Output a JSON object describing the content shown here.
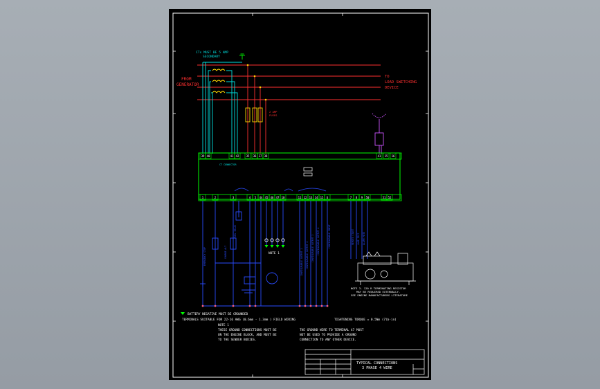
{
  "title_block": {
    "title_line1": "TYPICAL CONNECTIONS",
    "title_line2": "3 PHASE 4 WIRE"
  },
  "labels": {
    "ct_note_line1": "CTs MUST BE 5 AMP",
    "ct_note_line2": "SECONDARY",
    "from_generator_line1": "FROM",
    "from_generator_line2": "GENERATOR",
    "to_load_line1": "TO",
    "to_load_line2": "LOAD SWITCHING",
    "to_load_line3": "DEVICE",
    "fuses_line1": "2 AMP",
    "fuses_line2": "FUSES",
    "ct_connector_caption": "CT CONNECTOR",
    "note1_marker": "NOTE 1",
    "battery_negative": "BATTERY NEGATIVE MUST BE GROUNDED",
    "terminals_suitable": "TERMINALS SUITABLE FOR 22-16 AWG (0.6mm - 1.3mm ) FIELD WIRING",
    "tightening_torque": "TIGHTENING TORQUE = 0.5Nm (7lb-in)",
    "note1_heading": "NOTE 1",
    "note1_line1": "THESE GROUND CONNECTIONS MUST BE",
    "note1_line2": "ON THE ENGINE BLOCK, AND MUST BE",
    "note1_line3": "TO THE SENDER BODIES.",
    "note2_line1": "THE GROUND WIRE TO TERMINAL 47 MUST",
    "note2_line2": "NOT BE USED TO PROVIDE A GROUND",
    "note2_line3": "CONNECTION TO ANY OTHER DEVICE.",
    "note3_line1": "NOTE 3. 120 R TERMINATING RESISTOR",
    "note3_line2": "MAY BE REQUIRED EXTERNALLY.",
    "note3_line3": "SEE ENGINE MANUFACTURERS LITERATURE"
  },
  "top_terminals": [
    "39",
    "40",
    "41",
    "42",
    "35",
    "36",
    "37",
    "38"
  ],
  "top_right_terminals": [
    "41",
    "15",
    "16"
  ],
  "bottom_terminals": [
    "1",
    "2",
    "3",
    "4",
    "5",
    "44",
    "45",
    "46",
    "47",
    "10",
    "11",
    "12",
    "13",
    "14",
    "15",
    "6",
    "7",
    "8",
    "9",
    "50",
    "51",
    "52"
  ],
  "colors": {
    "sheet": "#000000",
    "border": "#ffffff",
    "phase_lines": "#ff3030",
    "ct_wiring": "#00e0e0",
    "module_outline": "#00ff00",
    "dc_wiring": "#2a4cff",
    "fuse": "#ffd700",
    "can_wiring": "#cc55ff",
    "ground_symbol": "#00ff00",
    "notes_text": "#ffffff",
    "labels_text": "#ff3030"
  }
}
